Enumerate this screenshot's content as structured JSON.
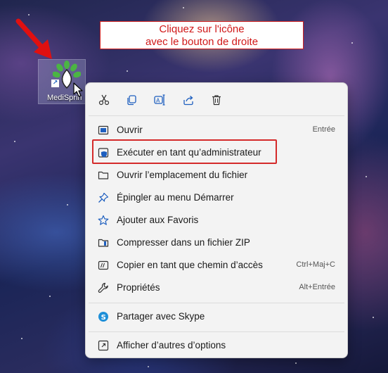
{
  "annotation": {
    "line1": "Cliquez sur l'icône",
    "line2": "avec le bouton de droite"
  },
  "desktop_icon": {
    "label": "MediSprin",
    "icon": "medisprint-logo-icon",
    "shortcut_glyph": "↗"
  },
  "toolbar": [
    {
      "name": "cut-icon",
      "tooltip": "Couper"
    },
    {
      "name": "copy-icon",
      "tooltip": "Copier"
    },
    {
      "name": "rename-icon",
      "tooltip": "Renommer"
    },
    {
      "name": "share-icon",
      "tooltip": "Partager"
    },
    {
      "name": "delete-icon",
      "tooltip": "Supprimer"
    }
  ],
  "menu": {
    "items": [
      {
        "label": "Ouvrir",
        "shortcut": "Entrée",
        "icon": "open-icon"
      },
      {
        "label": "Exécuter en tant qu’administrateur",
        "shortcut": "",
        "icon": "shield-icon"
      },
      {
        "label": "Ouvrir l’emplacement du fichier",
        "shortcut": "",
        "icon": "folder-icon"
      },
      {
        "label": "Épingler au menu Démarrer",
        "shortcut": "",
        "icon": "pin-icon"
      },
      {
        "label": "Ajouter aux Favoris",
        "shortcut": "",
        "icon": "star-icon"
      },
      {
        "label": "Compresser dans un fichier ZIP",
        "shortcut": "",
        "icon": "zip-icon"
      },
      {
        "label": "Copier en tant que chemin d’accès",
        "shortcut": "Ctrl+Maj+C",
        "icon": "path-icon"
      },
      {
        "label": "Propriétés",
        "shortcut": "Alt+Entrée",
        "icon": "wrench-icon"
      },
      {
        "label": "Partager avec Skype",
        "shortcut": "",
        "icon": "skype-icon"
      },
      {
        "label": "Afficher d’autres d’options",
        "shortcut": "",
        "icon": "more-options-icon"
      }
    ]
  },
  "colors": {
    "accent_red": "#d42a2a",
    "icon_blue": "#1e5fbf",
    "menu_bg": "#f3f3f3"
  }
}
